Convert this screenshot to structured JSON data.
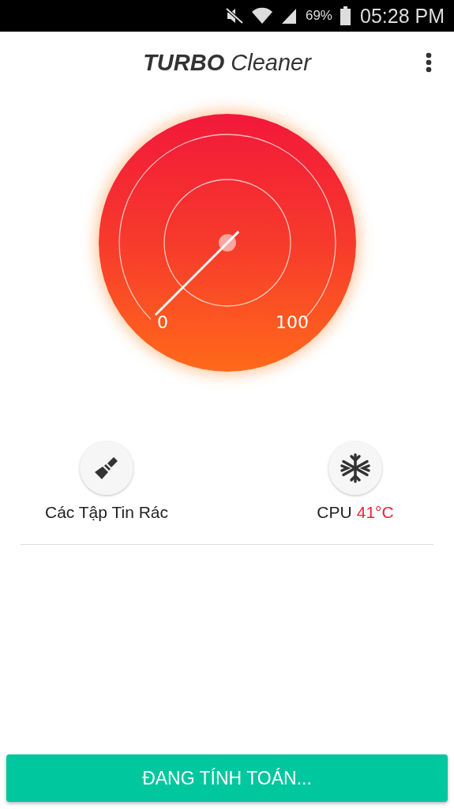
{
  "status_bar": {
    "battery": "69%",
    "time": "05:28 PM"
  },
  "app_bar": {
    "title": "**TURBO** Cleaner"
  },
  "gauge": {
    "min_label": "0",
    "max_label": "100"
  },
  "features": [
    {
      "kind": "junk",
      "label": "Các Tập Tin Rác"
    },
    {
      "kind": "cpu",
      "label": "CPU",
      "value": "41°C"
    }
  ],
  "action_button": {
    "label": "ĐANG TÍNH TOÁN..."
  }
}
